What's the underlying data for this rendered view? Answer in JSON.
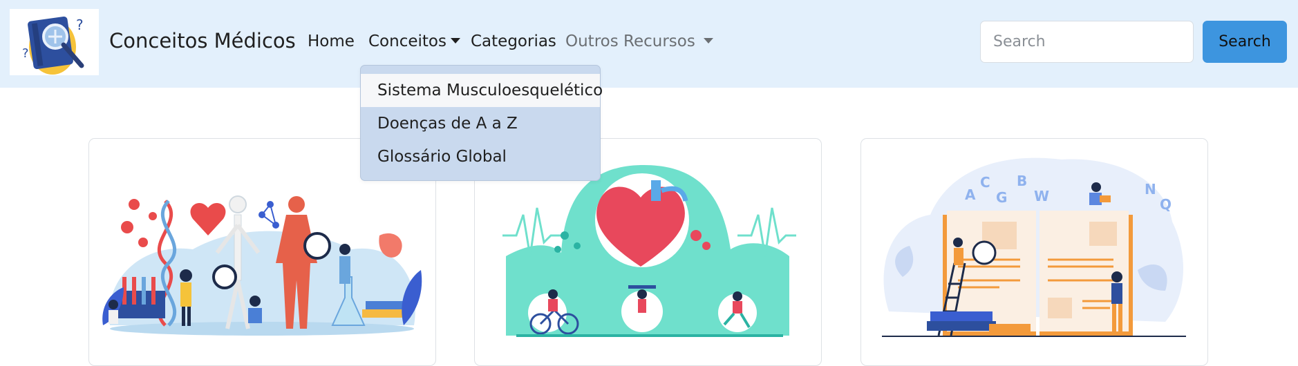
{
  "navbar": {
    "brand": "Conceitos Médicos",
    "links": {
      "home": "Home",
      "conceitos": "Conceitos",
      "categorias": "Categorias",
      "outros_recursos": "Outros Recursos"
    },
    "search": {
      "placeholder": "Search",
      "button_label": "Search"
    },
    "colors": {
      "background": "#e3f0fc",
      "search_button": "#3d95df"
    }
  },
  "dropdown": {
    "items": [
      {
        "label": "Sistema Musculoesquelético",
        "highlighted": true
      },
      {
        "label": "Doenças de A a Z"
      },
      {
        "label": "Glossário Global"
      }
    ],
    "background": "#c9d9ee"
  },
  "cards": [
    {
      "illustration": "medical-science-illustration"
    },
    {
      "illustration": "heart-health-illustration"
    },
    {
      "illustration": "glossary-book-illustration"
    }
  ]
}
